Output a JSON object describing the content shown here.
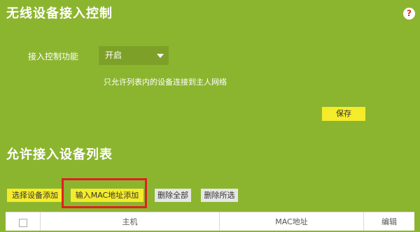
{
  "header": {
    "title": "无线设备接入控制",
    "help_symbol": "?"
  },
  "access_control": {
    "label": "接入控制功能",
    "selected": "开启",
    "hint": "只允许列表内的设备连接到主人网络",
    "save_label": "保存"
  },
  "allowed_list": {
    "title": "允许接入设备列表",
    "buttons": {
      "select_add": "选择设备添加",
      "mac_add": "输入MAC地址添加",
      "delete_all": "删除全部",
      "delete_selected": "删除所选"
    },
    "columns": {
      "host": "主机",
      "mac": "MAC地址",
      "edit": "编辑"
    }
  },
  "colors": {
    "background": "#8cb52f",
    "button_yellow": "#f4eb2a",
    "button_grey": "#e6e6e6",
    "highlight_red": "#e02020"
  }
}
